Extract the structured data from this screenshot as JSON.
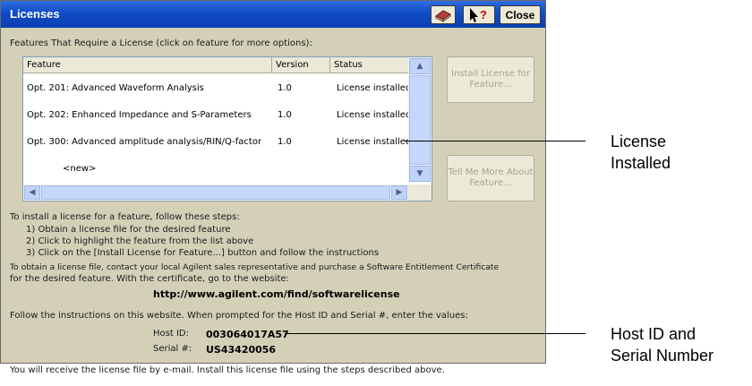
{
  "window": {
    "title": "Licenses",
    "help_icon": "help-book-icon",
    "whats_this_icon": "whats-this-cursor-icon",
    "close_label": "Close",
    "titlebar_color": "#0f4cc7",
    "background_color": "#d4d0b8"
  },
  "features_heading": "Features That Require a License (click on feature for more options):",
  "table": {
    "columns": [
      "Feature",
      "Version",
      "Status"
    ],
    "rows": [
      {
        "feature": "Opt. 201: Advanced Waveform Analysis",
        "version": "1.0",
        "status": "License installed"
      },
      {
        "feature": "Opt. 202: Enhanced Impedance and S-Parameters",
        "version": "1.0",
        "status": "License installed"
      },
      {
        "feature": "Opt. 300: Advanced amplitude analysis/RIN/Q-factor",
        "version": "1.0",
        "status": "License installed"
      },
      {
        "feature": "<new>",
        "version": "",
        "status": ""
      }
    ]
  },
  "buttons": {
    "install_license": "Install License for Feature...",
    "tell_me_more": "Tell Me More About Feature..."
  },
  "instructions": {
    "intro": "To install a license for a feature, follow these steps:",
    "step1": "1) Obtain a license file for the desired feature",
    "step2": "2) Click to highlight the feature from the list above",
    "step3": "3) Click on the [Install License for Feature...] button and follow the instructions",
    "obtain_line1": "To obtain a license file, contact your local Agilent sales representative and purchase a Software Entitlement Certificate",
    "obtain_line2": "for the desired feature.  With the certificate, go to the website:",
    "website": "http://www.agilent.com/find/softwarelicense",
    "follow": "Follow the instructions on this website.  When prompted for the Host ID and Serial #, enter the values:",
    "host_id_label": "Host ID:",
    "host_id_value": "003064017A57",
    "serial_label": "Serial #:",
    "serial_value": "US43420056",
    "email": "You will receive the license file by e-mail.  Install this license file using the steps described above."
  },
  "callouts": {
    "license_installed_1": "License",
    "license_installed_2": "Installed",
    "host_serial_1": "Host ID and",
    "host_serial_2": "Serial Number"
  }
}
